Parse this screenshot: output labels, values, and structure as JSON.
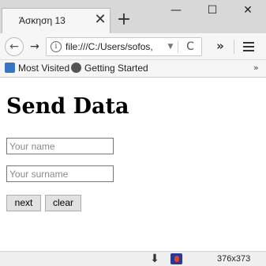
{
  "browser": {
    "tab": {
      "title": "Άσκηση 13",
      "close_glyph": "✕"
    },
    "new_tab_glyph": "+",
    "window_controls": {
      "minimize": "—",
      "maximize": "☐",
      "close": "✕"
    },
    "nav": {
      "back_glyph": "←",
      "forward_glyph": "→",
      "url": "file:///C:/Users/sofos,",
      "info_glyph": "i",
      "dropdown_glyph": "▼",
      "reload_glyph": "C",
      "overflow_glyph": "»"
    },
    "bookmarks": {
      "items": [
        {
          "label": "Most Visited",
          "icon": "most-visited-icon"
        },
        {
          "label": "Getting Started",
          "icon": "firefox-globe-icon"
        }
      ],
      "more_glyph": "»"
    }
  },
  "page": {
    "title": "Send Data",
    "name_field": {
      "placeholder": "Your name",
      "value": ""
    },
    "surname_field": {
      "placeholder": "Your surname",
      "value": ""
    },
    "buttons": {
      "next": "next",
      "clear": "clear"
    }
  },
  "status": {
    "download_glyph": "⬇",
    "size": "376x373"
  }
}
